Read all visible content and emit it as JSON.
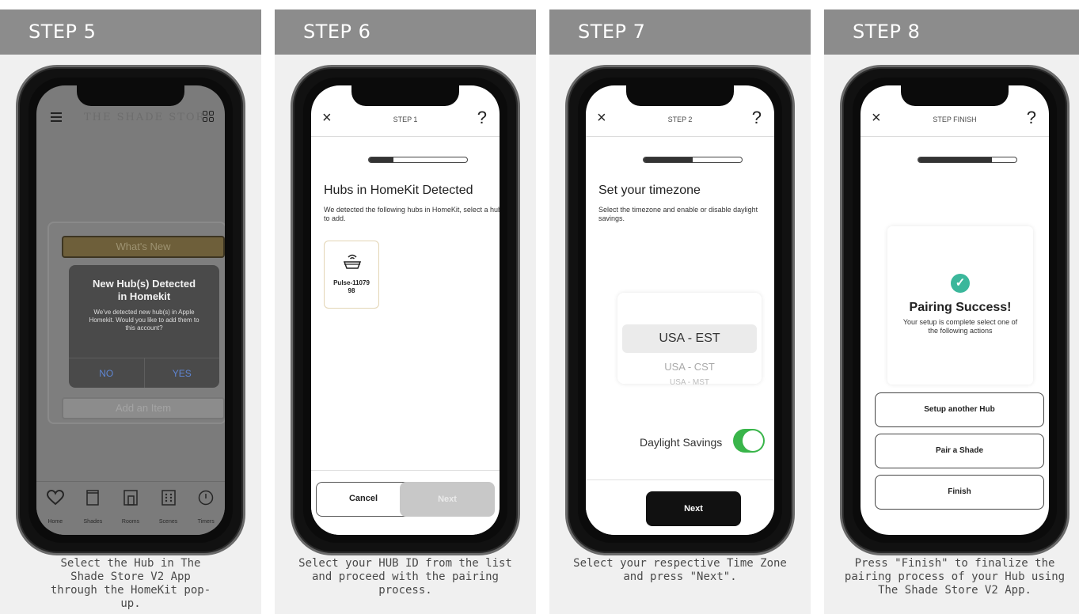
{
  "colors": {
    "panel_header_bg": "#8c8c8c",
    "panel_bg": "#f0f0f0",
    "toggle_on": "#39b54a",
    "success_check": "#3bb79b",
    "dialog_button": "#5f86d3"
  },
  "steps": [
    {
      "title": "STEP 5",
      "caption": "Select the Hub in The\nShade Store V2 App\nthrough the HomeKit pop-\nup.",
      "app": {
        "brand": "THE SHADE STORE",
        "whats_new": "What's New",
        "add_item": "Add an Item",
        "dialog": {
          "title": "New Hub(s) Detected\nin Homekit",
          "message": "We've detected new hub(s) in Apple\nHomekit. Would you like to add them to\nthis account?",
          "no_label": "NO",
          "yes_label": "YES"
        },
        "tabs": [
          {
            "label": "Home",
            "icon": "heart-icon"
          },
          {
            "label": "Shades",
            "icon": "shade-icon"
          },
          {
            "label": "Rooms",
            "icon": "room-icon"
          },
          {
            "label": "Scenes",
            "icon": "scene-icon"
          },
          {
            "label": "Timers",
            "icon": "clock-icon"
          }
        ]
      }
    },
    {
      "title": "STEP 6",
      "caption": "Select your HUB ID from the list\nand proceed with the pairing\nprocess.",
      "app": {
        "close": "×",
        "step_label": "STEP 1",
        "help": "?",
        "progress": 0.25,
        "heading": "Hubs in HomeKit Detected",
        "subtext": "We detected the following hubs in HomeKit, select a hub to add.",
        "hub_label": "Pulse-11079\n98",
        "cancel_label": "Cancel",
        "next_label": "Next"
      }
    },
    {
      "title": "STEP 7",
      "caption": "Select your respective Time Zone\nand press \"Next\".",
      "app": {
        "close": "×",
        "step_label": "STEP 2",
        "help": "?",
        "progress": 0.5,
        "heading": "Set your timezone",
        "subtext": "Select the timezone and enable or disable daylight savings.",
        "timezones": [
          "USA - EST",
          "USA - CST",
          "USA - MST"
        ],
        "selected_timezone": "USA - EST",
        "daylight_label": "Daylight Savings",
        "daylight_on": true,
        "next_label": "Next"
      }
    },
    {
      "title": "STEP 8",
      "caption": "Press \"Finish\" to finalize the\npairing process of your Hub using\nThe Shade Store V2 App.",
      "app": {
        "close": "×",
        "step_label": "STEP FINISH",
        "help": "?",
        "progress": 0.75,
        "success_title": "Pairing Success!",
        "success_sub": "Your setup is complete select one of the following actions",
        "actions": [
          "Setup another Hub",
          "Pair a Shade",
          "Finish"
        ]
      }
    }
  ]
}
